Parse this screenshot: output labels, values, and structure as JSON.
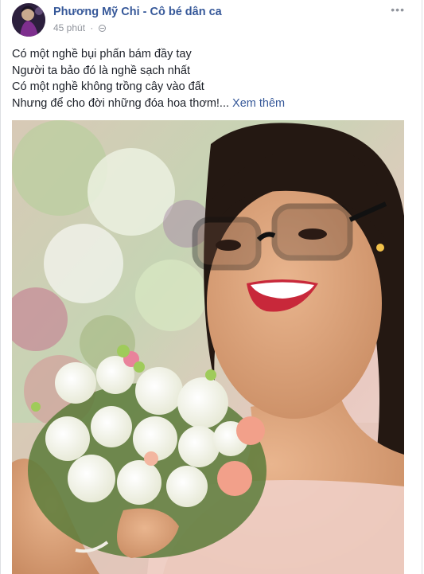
{
  "post": {
    "author": "Phương Mỹ Chi - Cô bé dân ca",
    "time": "45 phút",
    "separator": "·",
    "more_icon": "ellipsis-icon",
    "privacy_icon": "globe-icon",
    "lines": [
      "Có một nghề bụi phấn bám đầy tay",
      "Người ta bảo đó là nghề sạch nhất",
      "Có một nghề không trồng cây vào đất",
      "Nhưng để cho đời những đóa hoa thơm!..."
    ],
    "see_more": "Xem thêm"
  },
  "colors": {
    "link": "#365899",
    "meta": "#90949c",
    "text": "#1d2129"
  }
}
